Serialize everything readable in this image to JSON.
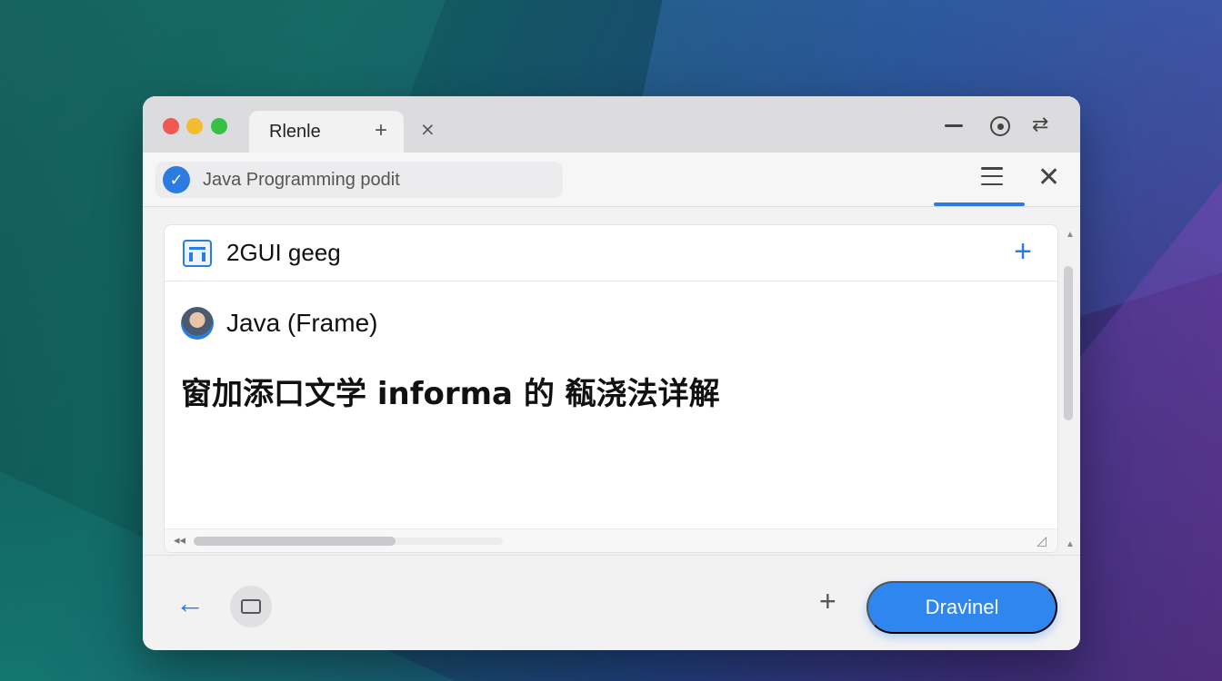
{
  "window": {
    "tab_label": "Rlenle",
    "tab_plus": "+",
    "tab_extra_icon": "⨯"
  },
  "addressbar": {
    "text": "Java Programming podit",
    "check_icon": "check-circle-icon",
    "close_glyph": "✕"
  },
  "panel": {
    "title": "2GUI geeg",
    "add_glyph": "+",
    "author": "Java (Frame)",
    "headline": "窗加添口文学 informa 的 瓻浇法详解"
  },
  "bottombar": {
    "back_glyph": "←",
    "plus_glyph": "+",
    "primary_button_label": "Dravinel"
  },
  "colors": {
    "accent": "#2c7be0",
    "button": "#2f86ee"
  }
}
